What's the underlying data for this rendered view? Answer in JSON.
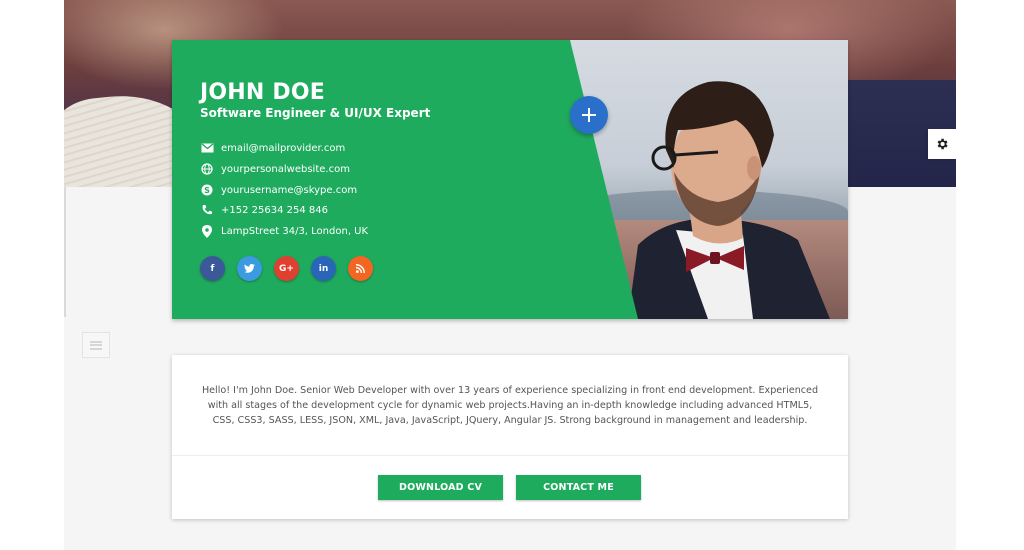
{
  "profile": {
    "name": "JOHN DOE",
    "title": "Software Engineer & UI/UX Expert",
    "email": "email@mailprovider.com",
    "website": "yourpersonalwebsite.com",
    "skype": "yourusername@skype.com",
    "phone": "+152 25634 254 846",
    "address": "LampStreet 34/3, London, UK",
    "accent_color": "#1fab5e"
  },
  "socials": [
    {
      "label": "f",
      "icon": "facebook-icon",
      "color": "#3b5998"
    },
    {
      "label": "t",
      "icon": "twitter-icon",
      "color": "#3a9be0"
    },
    {
      "label": "G+",
      "icon": "google-plus-icon",
      "color": "#e0402f"
    },
    {
      "label": "in",
      "icon": "linkedin-icon",
      "color": "#2a66b8"
    },
    {
      "label": "rss",
      "icon": "rss-icon",
      "color": "#f26522"
    }
  ],
  "about": {
    "text": "Hello! I'm John Doe. Senior Web Developer with over 13 years of experience specializing in front end development. Experienced with all stages of the development cycle for dynamic web projects.Having an in-depth knowledge including advanced HTML5, CSS, CSS3, SASS, LESS, JSON, XML, Java, JavaScript, JQuery, Angular JS. Strong background in management and leadership."
  },
  "buttons": {
    "download": "DOWNLOAD CV",
    "contact": "CONTACT ME"
  },
  "icons": {
    "fab": "plus-icon",
    "settings": "gear-icon",
    "menu": "menu-icon"
  }
}
